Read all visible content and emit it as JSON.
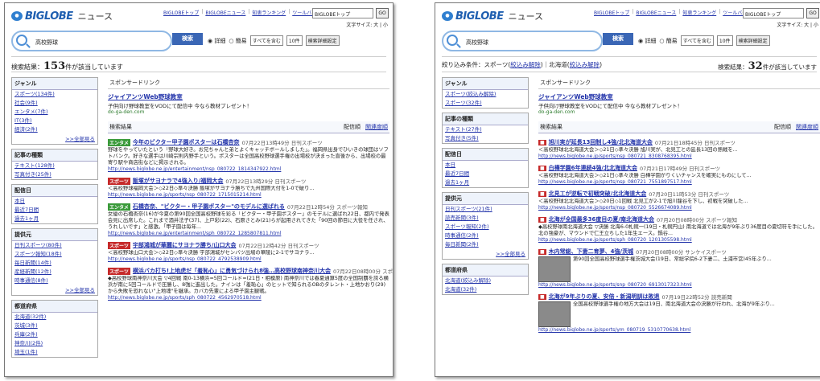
{
  "left": {
    "logo": "BIGLOBE",
    "service": "ニュース",
    "toplinks": [
      "BIGLOBEトップ",
      "BIGLOBEニュース",
      "知恵ランキング",
      "ツールバー"
    ],
    "select": "BIGLOBEトップ",
    "go": "GO",
    "textsize": "文字サイズ: 大 | 小",
    "query": "高校野球",
    "search_btn": "検索",
    "opt_detail": "詳細",
    "opt_simple": "簡易",
    "opt_include": "すべてを含む",
    "opt_count": "10件",
    "opt_adv": "検索詳細設定",
    "result_label": "検索結果：",
    "result_count": "153",
    "result_suffix": "件が該当しています",
    "genre_title": "ジャンル",
    "genres": [
      "スポーツ(134件)",
      "社会(9件)",
      "エンタメ(7件)",
      "IT(3件)",
      "経済(2件)"
    ],
    "more": ">>全部見る",
    "kind_title": "記事の種類",
    "kinds": [
      "テキスト(128件)",
      "写真付き(25件)"
    ],
    "date_title": "配信日",
    "dates": [
      "本日",
      "最近7日間",
      "過去1ヶ月"
    ],
    "prov_title": "提供元",
    "provs": [
      "日刊スポーツ(80件)",
      "スポーツ報知(18件)",
      "毎日新聞(14件)",
      "産経新聞(12件)",
      "時事通信(8件)"
    ],
    "pref_title": "都道府県",
    "prefs": [
      "北海道(32件)",
      "茨城(3件)",
      "兵庫(2件)",
      "神奈川(2件)",
      "埼玉(1件)"
    ],
    "sponsor": "スポンサードリンク",
    "ad_title": "ジャイアンツWeb野球教室",
    "ad_desc": "子供向け野球教室をVODにて配信中 今なら教材プレゼント！",
    "ad_url": "do-ga-den.com",
    "results_title": "検索結果",
    "sort1": "配信順",
    "sort2": "関連度順",
    "items": [
      {
        "cat": "エンタメ",
        "cls": "e",
        "title": "今年のビクター甲子園ポスターは石橋杏奈",
        "date": "07月22日13時49分 日刊スポーツ",
        "body": "野球をやっていたという「野球大好き。お兄ちゃんと弟とよくキャッチボールしました」。福岡県出身でひいきの球団はソフトバンク。好きな選手は川崎宗則内野手という。ポスターは全国高校野球選手権の出場校が決まった直後から、出場校の最寄り駅や商店街などに掲示される。",
        "url": "http://news.biglobe.ne.jp/entertainment/nsp_080722_1814347922.html"
      },
      {
        "cat": "スポーツ",
        "cls": "s",
        "title": "飯塚がサヨナラで4強入り/福岡大会",
        "date": "07月22日13時29分 日刊スポーツ",
        "body": "＜高校野球福岡大会＞◇22日◇準々決勝 飯塚がサヨナラ勝ちで九州国際大付を1-0で破り...",
        "url": "http://news.biglobe.ne.jp/sports/nsp_080722_1715015214.html"
      },
      {
        "cat": "エンタメ",
        "cls": "e",
        "title": "石橋杏奈、\"ビクター・甲子園ポスター\"のモデルに選ばれる",
        "date": "07月22日12時54分 スポーツ報知",
        "body": "女優の石橋杏奈(16)が今夏の第90回全国高校野球を彩る「ビクター・甲子園ポスター」のモデルに選ばれ22日、都内で発表会見に出席した。これまで酒井法子(37)、上戸彩(22)、石原さとみ(21)らが起用されてきた「90回の節目に大役を任され、うれしいです」と感激。「甲子園は毎年...",
        "url": "http://news.biglobe.ne.jp/entertainment/sph_080722_1285807811.html"
      },
      {
        "cat": "スポーツ",
        "cls": "s",
        "title": "宇部鴻城が華麗にサヨナラ勝ち/山口大会",
        "date": "07月22日12時42分 日刊スポーツ",
        "body": "＜高校野球山口大会＞◇22日◇準々決勝 宇部鴻城がセンバツ出場の華陵に2-1でサヨナラ...",
        "url": "http://news.biglobe.ne.jp/sports/nsp_080722_4792538909.html"
      },
      {
        "cat": "スポーツ",
        "cls": "s",
        "title": "横浜バカ打ち!上地虎だ「羞恥心」に勇気づけられ8強…高校野球南神奈川大会",
        "date": "07月22日08時00分 スポーツ報知",
        "body": "◆高校野球南神奈川大会 ▽4回戦 南0-13横浜=5回コールド=(21日・相模原) 南神奈川では春夏通算5度の全国制覇を誇る横浜が南に5回コールドで圧勝し、8強に進出した。ナインは「羞恥心」のヒットで知られるOBのタレント・上地かおり(29)から失敗を恐れない\"上地魂\"を継承。カバカ先輩による甲子園主観戦。",
        "url": "http://news.biglobe.ne.jp/sports/sph_080722_4562970518.html"
      }
    ]
  },
  "right": {
    "filter_label": "絞り込み条件：スポーツ",
    "unset1": "絞込み解除",
    "filter_mid": "｜北海道",
    "unset2": "絞込み解除",
    "filter_close": "）",
    "result_label": "検索結果：",
    "result_count": "32",
    "result_suffix": "件が該当しています",
    "genres": [
      "スポーツ(絞込み解除)",
      "スポーツ(32件)"
    ],
    "kinds": [
      "テキスト(27件)",
      "写真付き(5件)"
    ],
    "dates": [
      "本日",
      "最近7日間",
      "過去1ヶ月"
    ],
    "provs": [
      "日刊スポーツ(21件)",
      "読売新聞(3件)",
      "スポーツ報知(2件)",
      "時事通信(2件)",
      "毎日新聞(2件)"
    ],
    "prefs": [
      "北海道(絞込み解除)",
      "北海道(32件)"
    ],
    "items": [
      {
        "title": "旭川実が延長13回制し4強/北北海道大会",
        "date": "07月21日18時45分 日刊スポーツ",
        "body": "＜高校野球北北海道大会＞◇21日◇準々決勝 旭川実が、北見工との延長13回の熱戦を...",
        "url": "http://news.biglobe.ne.jp/sports/nsp_080721_8308768395.html"
      },
      {
        "title": "白樺学園6年連続4強/北北海道大会",
        "date": "07月21日17時49分 日刊スポーツ",
        "body": "＜高校野球北北海道大会＞◇21日◇準々決勝 白樺学園がりくいチャンスを確実にものにして...",
        "url": "http://news.biglobe.ne.jp/sports/nsp_080721_7551897517.html"
      },
      {
        "title": "北見工が逆転で初戦突破/北北海道大会",
        "date": "07月20日11時53分 日刊スポーツ",
        "body": "＜高校野球北北海道大会＞◇20日◇1回戦 北見工が2-1で旭川龍谷を下し、初戦を突破した...",
        "url": "http://news.biglobe.ne.jp/sports/nsp_080720_5526674089.html"
      },
      {
        "title": "北海が全国最多36度目の夏/南北海道大会",
        "date": "07月20日08時00分 スポーツ報知",
        "body": "◆高校野球南北海道大会 ▽決勝 北海6-0札幌一(19日・札幌円山) 南北海道では北海が9年ぶり36度目の夏切符を手にした。北の強豪が、マウンドで仁王立ちした1年生エース。鍋谷...",
        "url": "http://news.biglobe.ne.jp/sports/sph_080720_1201305598.html"
      },
      {
        "title": "木内常総、下妻二育夢、4強/茨城",
        "date": "07月20日08時00分 サンケイスポーツ",
        "body": "第90回全国高校野球選手権茨城大会(19日、常総学院6-2下妻二、土浦市営)45年ぶり...",
        "url": "http://news.biglobe.ne.jp/sports/snp_080720_6913017323.html"
      },
      {
        "title": "北海が9年ぶりの夏、安倍・新潟明訓は敗退",
        "date": "07月19日22時52分 読売新聞",
        "body": "全国高校野球選手権の地方大会は19日、南北海道大会の決勝が行われ、北海が9年ぶり...",
        "url": "http://news.biglobe.ne.jp/sports/ym_080719_5310770638.html"
      }
    ]
  }
}
